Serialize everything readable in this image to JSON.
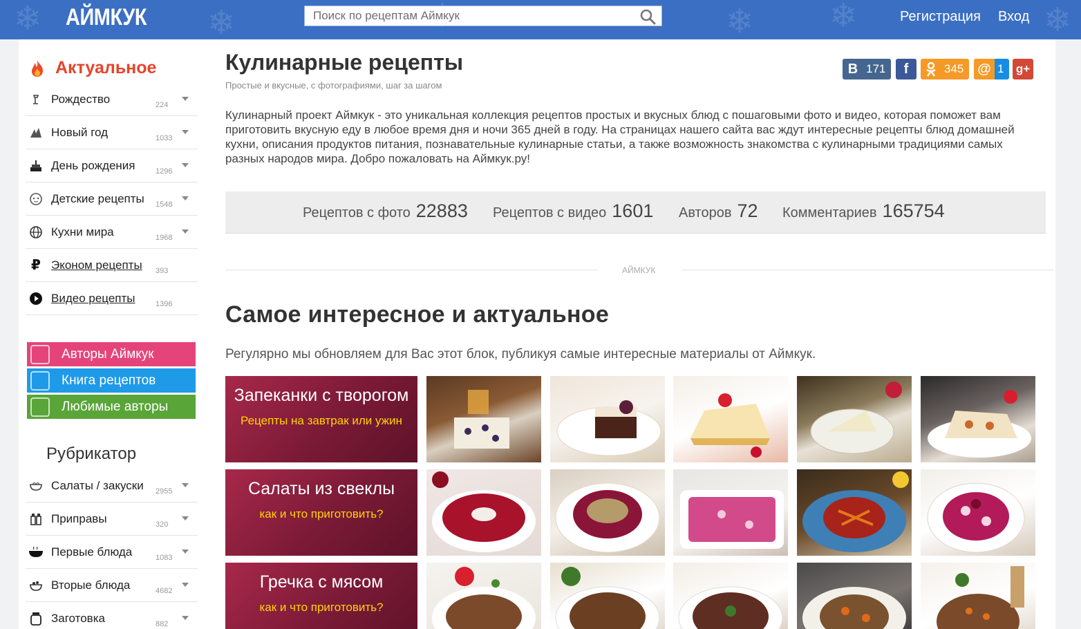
{
  "header": {
    "logo": "АЙМКУК",
    "search_placeholder": "Поиск по рецептам Аймкук",
    "register": "Регистрация",
    "login": "Вход"
  },
  "sidebar": {
    "actual_title": "Актуальное",
    "menu": [
      {
        "label": "Рождество",
        "count": "224",
        "icon": "christmas-icon"
      },
      {
        "label": "Новый год",
        "count": "1033",
        "icon": "new-year-icon"
      },
      {
        "label": "День рождения",
        "count": "1296",
        "icon": "birthday-cake-icon"
      },
      {
        "label": "Детские рецепты",
        "count": "1548",
        "icon": "kids-icon"
      },
      {
        "label": "Кухни мира",
        "count": "1968",
        "icon": "globe-icon"
      },
      {
        "label": "Эконом рецепты",
        "count": "393",
        "icon": "ruble-icon"
      },
      {
        "label": "Видео рецепты",
        "count": "1396",
        "icon": "play-icon"
      }
    ],
    "buttons": {
      "authors": "Авторы Аймкук",
      "book": "Книга рецептов",
      "favorites": "Любимые авторы"
    },
    "rubricator_title": "Рубрикатор",
    "rubricator": [
      {
        "label": "Салаты / закуски",
        "count": "2955",
        "icon": "salad-icon"
      },
      {
        "label": "Приправы",
        "count": "320",
        "icon": "spices-icon"
      },
      {
        "label": "Первые блюда",
        "count": "1083",
        "icon": "soup-icon"
      },
      {
        "label": "Вторые блюда",
        "count": "4682",
        "icon": "main-dish-icon"
      },
      {
        "label": "Заготовка",
        "count": "882",
        "icon": "jar-icon"
      }
    ]
  },
  "main": {
    "title": "Кулинарные рецепты",
    "subtitle": "Простые и вкусные, с фотографиями, шаг за шагом",
    "description": "Кулинарный проект Аймкук - это уникальная коллекция рецептов простых и вкусных блюд с пошаговыми фото и видео, которая поможет вам приготовить вкусную еду в любое время дня и ночи 365 дней в году. На страницах нашего сайта вас ждут интересные рецепты блюд домашней кухни, описания продуктов питания, познавательные кулинарные статьи, а также возможность знакомства с кулинарными традициями самых разных народов мира. Добро пожаловать на Аймкук.ру!",
    "share": {
      "vk": "171",
      "ok": "345",
      "mail": "1"
    },
    "stats": [
      {
        "label": "Рецептов с фото",
        "value": "22883"
      },
      {
        "label": "Рецептов с видео",
        "value": "1601"
      },
      {
        "label": "Авторов",
        "value": "72"
      },
      {
        "label": "Комментариев",
        "value": "165754"
      }
    ],
    "divider_label": "АЙМКУК",
    "section_title": "Самое интересное и актуальное",
    "section_lead": "Регулярно мы обновляем для Вас этот блок, публикуя самые интересные материалы от Аймкук.",
    "rows": [
      {
        "title": "Запеканки с творогом",
        "subtitle": "Рецепты на завтрак или ужин"
      },
      {
        "title": "Салаты из свеклы",
        "subtitle": "как и что приготовить?"
      },
      {
        "title": "Гречка с мясом",
        "subtitle": "как и что приготовить?"
      }
    ],
    "colors": {
      "header": "#3b6fc4",
      "accent": "#e8432a",
      "card": "#8b1f3f",
      "card_subtitle": "#ffd400"
    }
  }
}
